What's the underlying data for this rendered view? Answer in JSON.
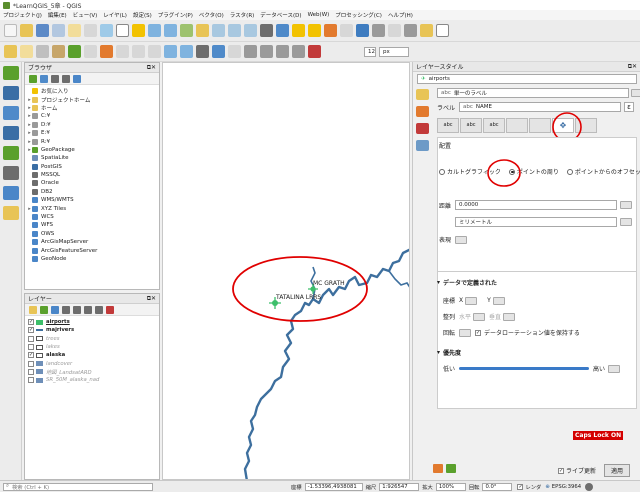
{
  "window": {
    "title": "*LearnQGIS_5章 - QGIS"
  },
  "menu": [
    "プロジェクト(J)",
    "編集(E)",
    "ビュー(V)",
    "レイヤ(L)",
    "設定(S)",
    "プラグイン(P)",
    "ベクタ(O)",
    "ラスタ(R)",
    "データベース(D)",
    "Web(W)",
    "プロセッシング(C)",
    "ヘルプ(H)"
  ],
  "toolbar2": {
    "font_size_value": "12",
    "unit": "px"
  },
  "browser": {
    "title": "ブラウザ",
    "items": [
      {
        "label": "お気に入り",
        "icon": "star-icon",
        "color": "#f2c200",
        "expand": ""
      },
      {
        "label": "プロジェクトホーム",
        "icon": "folder-icon",
        "color": "#e8c456",
        "expand": "▸"
      },
      {
        "label": "ホーム",
        "icon": "folder-icon",
        "color": "#e8c456",
        "expand": "▸"
      },
      {
        "label": "C:¥",
        "icon": "drive-icon",
        "color": "#9a9a9a",
        "expand": "▸"
      },
      {
        "label": "D:¥",
        "icon": "drive-icon",
        "color": "#9a9a9a",
        "expand": "▸"
      },
      {
        "label": "E:¥",
        "icon": "drive-icon",
        "color": "#9a9a9a",
        "expand": "▸"
      },
      {
        "label": "R:¥",
        "icon": "drive-icon",
        "color": "#9a9a9a",
        "expand": "▸"
      },
      {
        "label": "GeoPackage",
        "icon": "geopackage-icon",
        "color": "#5aa02c",
        "expand": "▸"
      },
      {
        "label": "SpatiaLite",
        "icon": "spatialite-icon",
        "color": "#6e8fb8",
        "expand": ""
      },
      {
        "label": "PostGIS",
        "icon": "postgis-icon",
        "color": "#3a6ea5",
        "expand": ""
      },
      {
        "label": "MSSQL",
        "icon": "mssql-icon",
        "color": "#6d6d6d",
        "expand": ""
      },
      {
        "label": "Oracle",
        "icon": "oracle-icon",
        "color": "#6d6d6d",
        "expand": ""
      },
      {
        "label": "DB2",
        "icon": "db2-icon",
        "color": "#6d6d6d",
        "expand": ""
      },
      {
        "label": "WMS/WMTS",
        "icon": "wms-icon",
        "color": "#4a86c8",
        "expand": ""
      },
      {
        "label": "XYZ Tiles",
        "icon": "xyz-tiles-icon",
        "color": "#4a86c8",
        "expand": "▸"
      },
      {
        "label": "WCS",
        "icon": "wcs-icon",
        "color": "#4a86c8",
        "expand": ""
      },
      {
        "label": "WFS",
        "icon": "wfs-icon",
        "color": "#4a86c8",
        "expand": ""
      },
      {
        "label": "OWS",
        "icon": "ows-icon",
        "color": "#4a86c8",
        "expand": ""
      },
      {
        "label": "ArcGisMapServer",
        "icon": "arcgis-icon",
        "color": "#4a86c8",
        "expand": ""
      },
      {
        "label": "ArcGisFeatureServer",
        "icon": "arcgis-icon",
        "color": "#4a86c8",
        "expand": ""
      },
      {
        "label": "GeoNode",
        "icon": "geonode-icon",
        "color": "#4a86c8",
        "expand": ""
      }
    ]
  },
  "layers": {
    "title": "レイヤー",
    "items": [
      {
        "label": "airports",
        "checked": true,
        "bold": true,
        "gray": false,
        "symbol": "airport-symbol"
      },
      {
        "label": "majrivers",
        "checked": true,
        "bold": true,
        "gray": false,
        "symbol": "line-symbol"
      },
      {
        "label": "trees",
        "checked": false,
        "bold": false,
        "gray": true,
        "symbol": "polygon-symbol"
      },
      {
        "label": "lakes",
        "checked": false,
        "bold": false,
        "gray": true,
        "symbol": "polygon-symbol"
      },
      {
        "label": "alaska",
        "checked": true,
        "bold": true,
        "gray": false,
        "symbol": "polygon-symbol"
      },
      {
        "label": "landcover",
        "checked": false,
        "bold": false,
        "gray": true,
        "symbol": "raster-symbol"
      },
      {
        "label": "地図_LandsatARD",
        "checked": false,
        "bold": false,
        "gray": true,
        "symbol": "raster-symbol"
      },
      {
        "label": "SR_50M_alaska_nad",
        "checked": false,
        "bold": false,
        "gray": true,
        "symbol": "raster-symbol"
      }
    ]
  },
  "map": {
    "labels": [
      {
        "text": "TATALINA LRRS",
        "key": "tatalina"
      },
      {
        "text": "MC GRATH",
        "key": "mcgrath"
      }
    ],
    "river_color": "#3d6f9e",
    "annotation_color": "#e00000"
  },
  "style_panel": {
    "title": "レイヤースタイル",
    "layer_select": "airports",
    "renderer": "単一のラベル",
    "label_caption": "ラベル",
    "label_field": "NAME",
    "placement_heading": "配置",
    "placement_options": [
      {
        "label": "カルトグラフィック",
        "selected": false
      },
      {
        "label": "ポイントの周り",
        "selected": true
      },
      {
        "label": "ポイントからのオフセット",
        "selected": false
      }
    ],
    "distance_label": "距離",
    "distance_value": "0.0000",
    "unit_value": "ミリメートル",
    "symbol_label": "表現",
    "data_defined_heading": "データで定義された",
    "coord_label": "座標",
    "x_label": "X",
    "y_label": "Y",
    "align_label": "整列",
    "align_h": "水平",
    "align_v": "垂直",
    "rotation_label": "回転",
    "keep_rotation": "データローテーション値を保持する",
    "priority_heading": "優先度",
    "priority_low": "低い",
    "priority_high": "高い",
    "caps_lock": "Caps Lock ON",
    "live_update": "ライブ更新",
    "apply": "適用"
  },
  "status": {
    "search_placeholder": "検索 (Ctrl + K)",
    "coord_label": "座標",
    "coord_value": "-1.53396,4938081",
    "scale_label": "縮尺",
    "scale_value": "1:926547",
    "magnifier_label": "拡大",
    "magnifier_value": "100%",
    "rotation_label": "回転",
    "rotation_value": "0.0°",
    "render_label": "レンダ",
    "crs": "EPSG:3964"
  }
}
